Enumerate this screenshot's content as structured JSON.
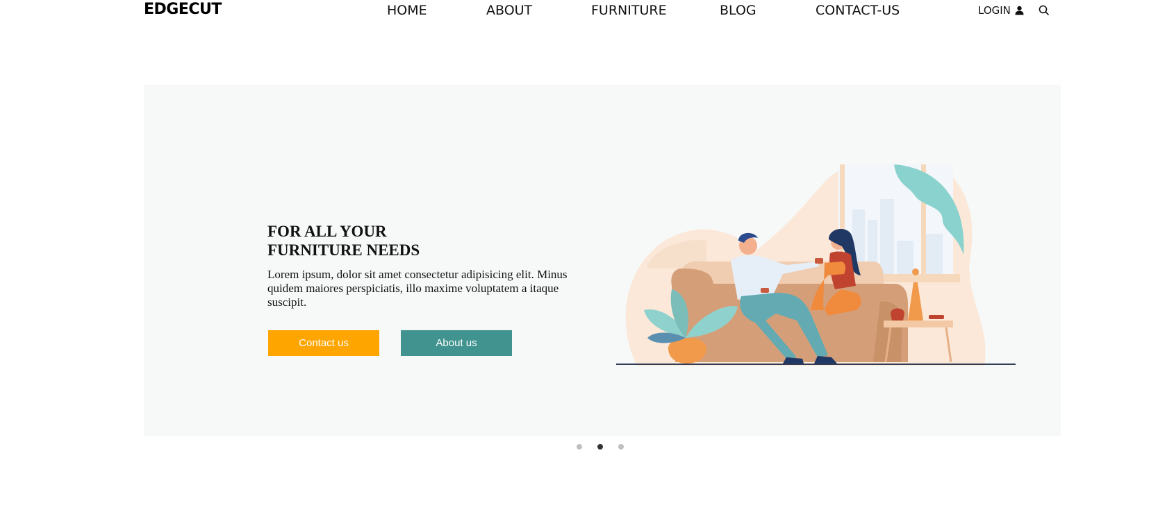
{
  "brand": "EDGECUT",
  "nav": {
    "items": [
      "HOME",
      "ABOUT",
      "FURNITURE",
      "BLOG",
      "CONTACT-US"
    ],
    "login_label": "LOGIN",
    "login_icon": "user-icon",
    "search_icon": "search-icon"
  },
  "hero": {
    "title_line1": "FOR ALL YOUR",
    "title_line2": "FURNITURE NEEDS",
    "text": "Lorem ipsum, dolor sit amet consectetur adipisicing elit. Minus quidem maiores perspiciatis, illo maxime voluptatem a itaque suscipit.",
    "contact_button": "Contact us",
    "about_button": "About us",
    "illustration": "couple-on-sofa-illustration"
  },
  "carousel": {
    "slide_count": 3,
    "active_index": 1
  },
  "colors": {
    "contact_button": "#ffa500",
    "about_button": "#41938f",
    "hero_background": "#f7f9f8"
  }
}
